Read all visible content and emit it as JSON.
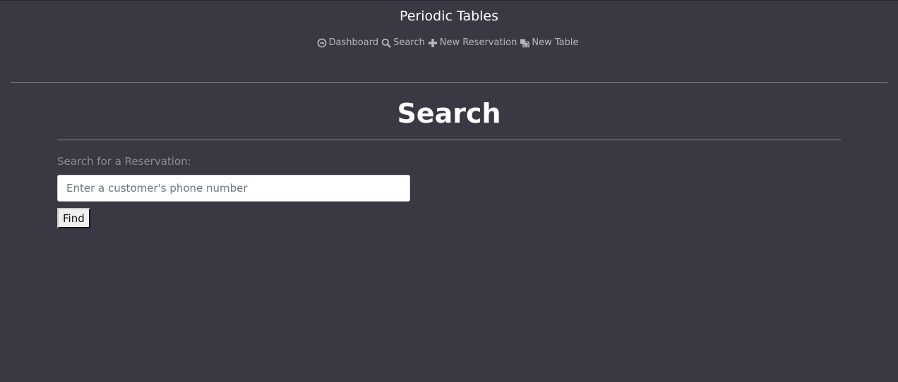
{
  "header": {
    "title": "Periodic Tables"
  },
  "nav": {
    "items": [
      {
        "label": "Dashboard",
        "icon": "dashboard-icon"
      },
      {
        "label": "Search",
        "icon": "search-icon"
      },
      {
        "label": "New Reservation",
        "icon": "plus-icon"
      },
      {
        "label": "New Table",
        "icon": "layers-icon"
      }
    ]
  },
  "main": {
    "title": "Search",
    "search_label": "Search for a Reservation:",
    "search_placeholder": "Enter a customer's phone number",
    "search_value": "",
    "find_label": "Find"
  },
  "colors": {
    "background": "#393843",
    "nav_text": "#b9b8c0",
    "label_text": "#8e8d96",
    "rule": "#8b8a93"
  }
}
